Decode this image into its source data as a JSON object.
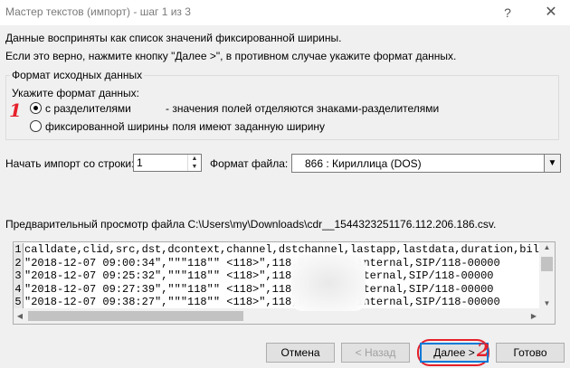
{
  "window": {
    "title": "Мастер текстов (импорт) - шаг 1 из 3",
    "help_glyph": "?",
    "close_glyph": "✕"
  },
  "intro": {
    "line1": "Данные восприняты как список значений фиксированной ширины.",
    "line2": "Если это верно, нажмите кнопку \"Далее >\", в противном случае укажите формат данных."
  },
  "source_format": {
    "legend": "Формат исходных данных",
    "prompt": "Укажите формат данных:",
    "options": [
      {
        "label": "с разделителями",
        "description": "- значения полей отделяются знаками-разделителями",
        "checked": true
      },
      {
        "label": "фиксированной ширины",
        "description": "- поля имеют заданную ширину",
        "checked": false
      }
    ]
  },
  "start_row": {
    "label": "Начать импорт со строки:",
    "value": "1"
  },
  "file_format": {
    "label": "Формат файла:",
    "value": "866 : Кириллица (DOS)"
  },
  "preview": {
    "label": "Предварительный просмотр файла C:\\Users\\my\\Downloads\\cdr__1544323251176.112.206.186.csv.",
    "lines": [
      {
        "num": "1",
        "text": "calldate,clid,src,dst,dcontext,channel,dstchannel,lastapp,lastdata,duration,billsec"
      },
      {
        "num": "2",
        "text": "\"2018-12-07 09:00:34\",\"\"\"118\"\" <118>\",118,8          5,from-internal,SIP/118-00000"
      },
      {
        "num": "3",
        "text": "\"2018-12-07 09:25:32\",\"\"\"118\"\" <118>\",118,8          ,from-internal,SIP/118-00000"
      },
      {
        "num": "4",
        "text": "\"2018-12-07 09:27:39\",\"\"\"118\"\" <118>\",118,8          ,from-internal,SIP/118-00000"
      },
      {
        "num": "5",
        "text": "\"2018-12-07 09:38:27\",\"\"\"118\"\" <118>\",118,8          7,from-internal,SIP/118-00000"
      }
    ]
  },
  "buttons": {
    "cancel": "Отмена",
    "back": "< Назад",
    "next": "Далее >",
    "finish": "Готово"
  },
  "annotations": {
    "one": "1",
    "two": "2"
  },
  "colors": {
    "annotation": "#e5202a",
    "focus": "#0078d7",
    "dialog_bg": "#f0f0f0"
  }
}
